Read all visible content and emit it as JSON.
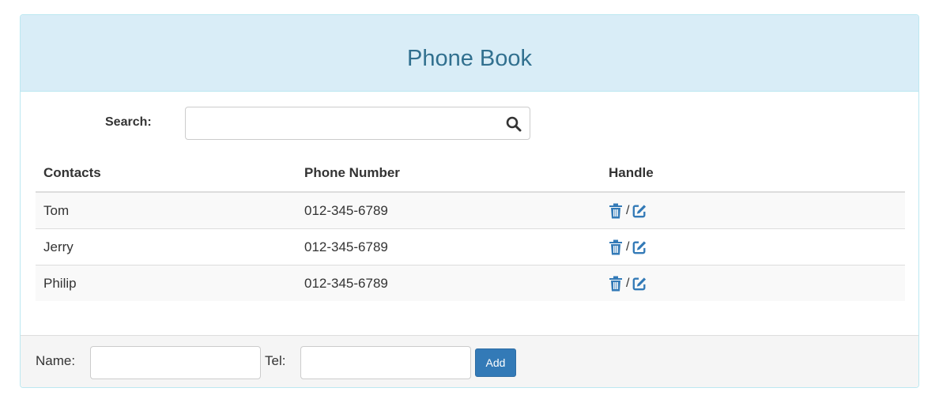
{
  "header": {
    "title": "Phone Book"
  },
  "search": {
    "label": "Search:",
    "value": "",
    "placeholder": ""
  },
  "table": {
    "columns": [
      "Contacts",
      "Phone Number",
      "Handle"
    ],
    "rows": [
      {
        "contact": "Tom",
        "phone": "012-345-6789",
        "separator": "/"
      },
      {
        "contact": "Jerry",
        "phone": "012-345-6789",
        "separator": "/"
      },
      {
        "contact": "Philip",
        "phone": "012-345-6789",
        "separator": "/"
      }
    ]
  },
  "footer": {
    "name_label": "Name:",
    "name_value": "",
    "tel_label": "Tel:",
    "tel_value": "",
    "add_label": "Add"
  },
  "icons": {
    "search": "search-icon",
    "delete": "trash-icon",
    "edit": "edit-icon"
  },
  "colors": {
    "header_bg": "#d9edf7",
    "title": "#31708f",
    "accent": "#337ab7",
    "stripe": "#f9f9f9",
    "footer_bg": "#f5f5f5"
  }
}
